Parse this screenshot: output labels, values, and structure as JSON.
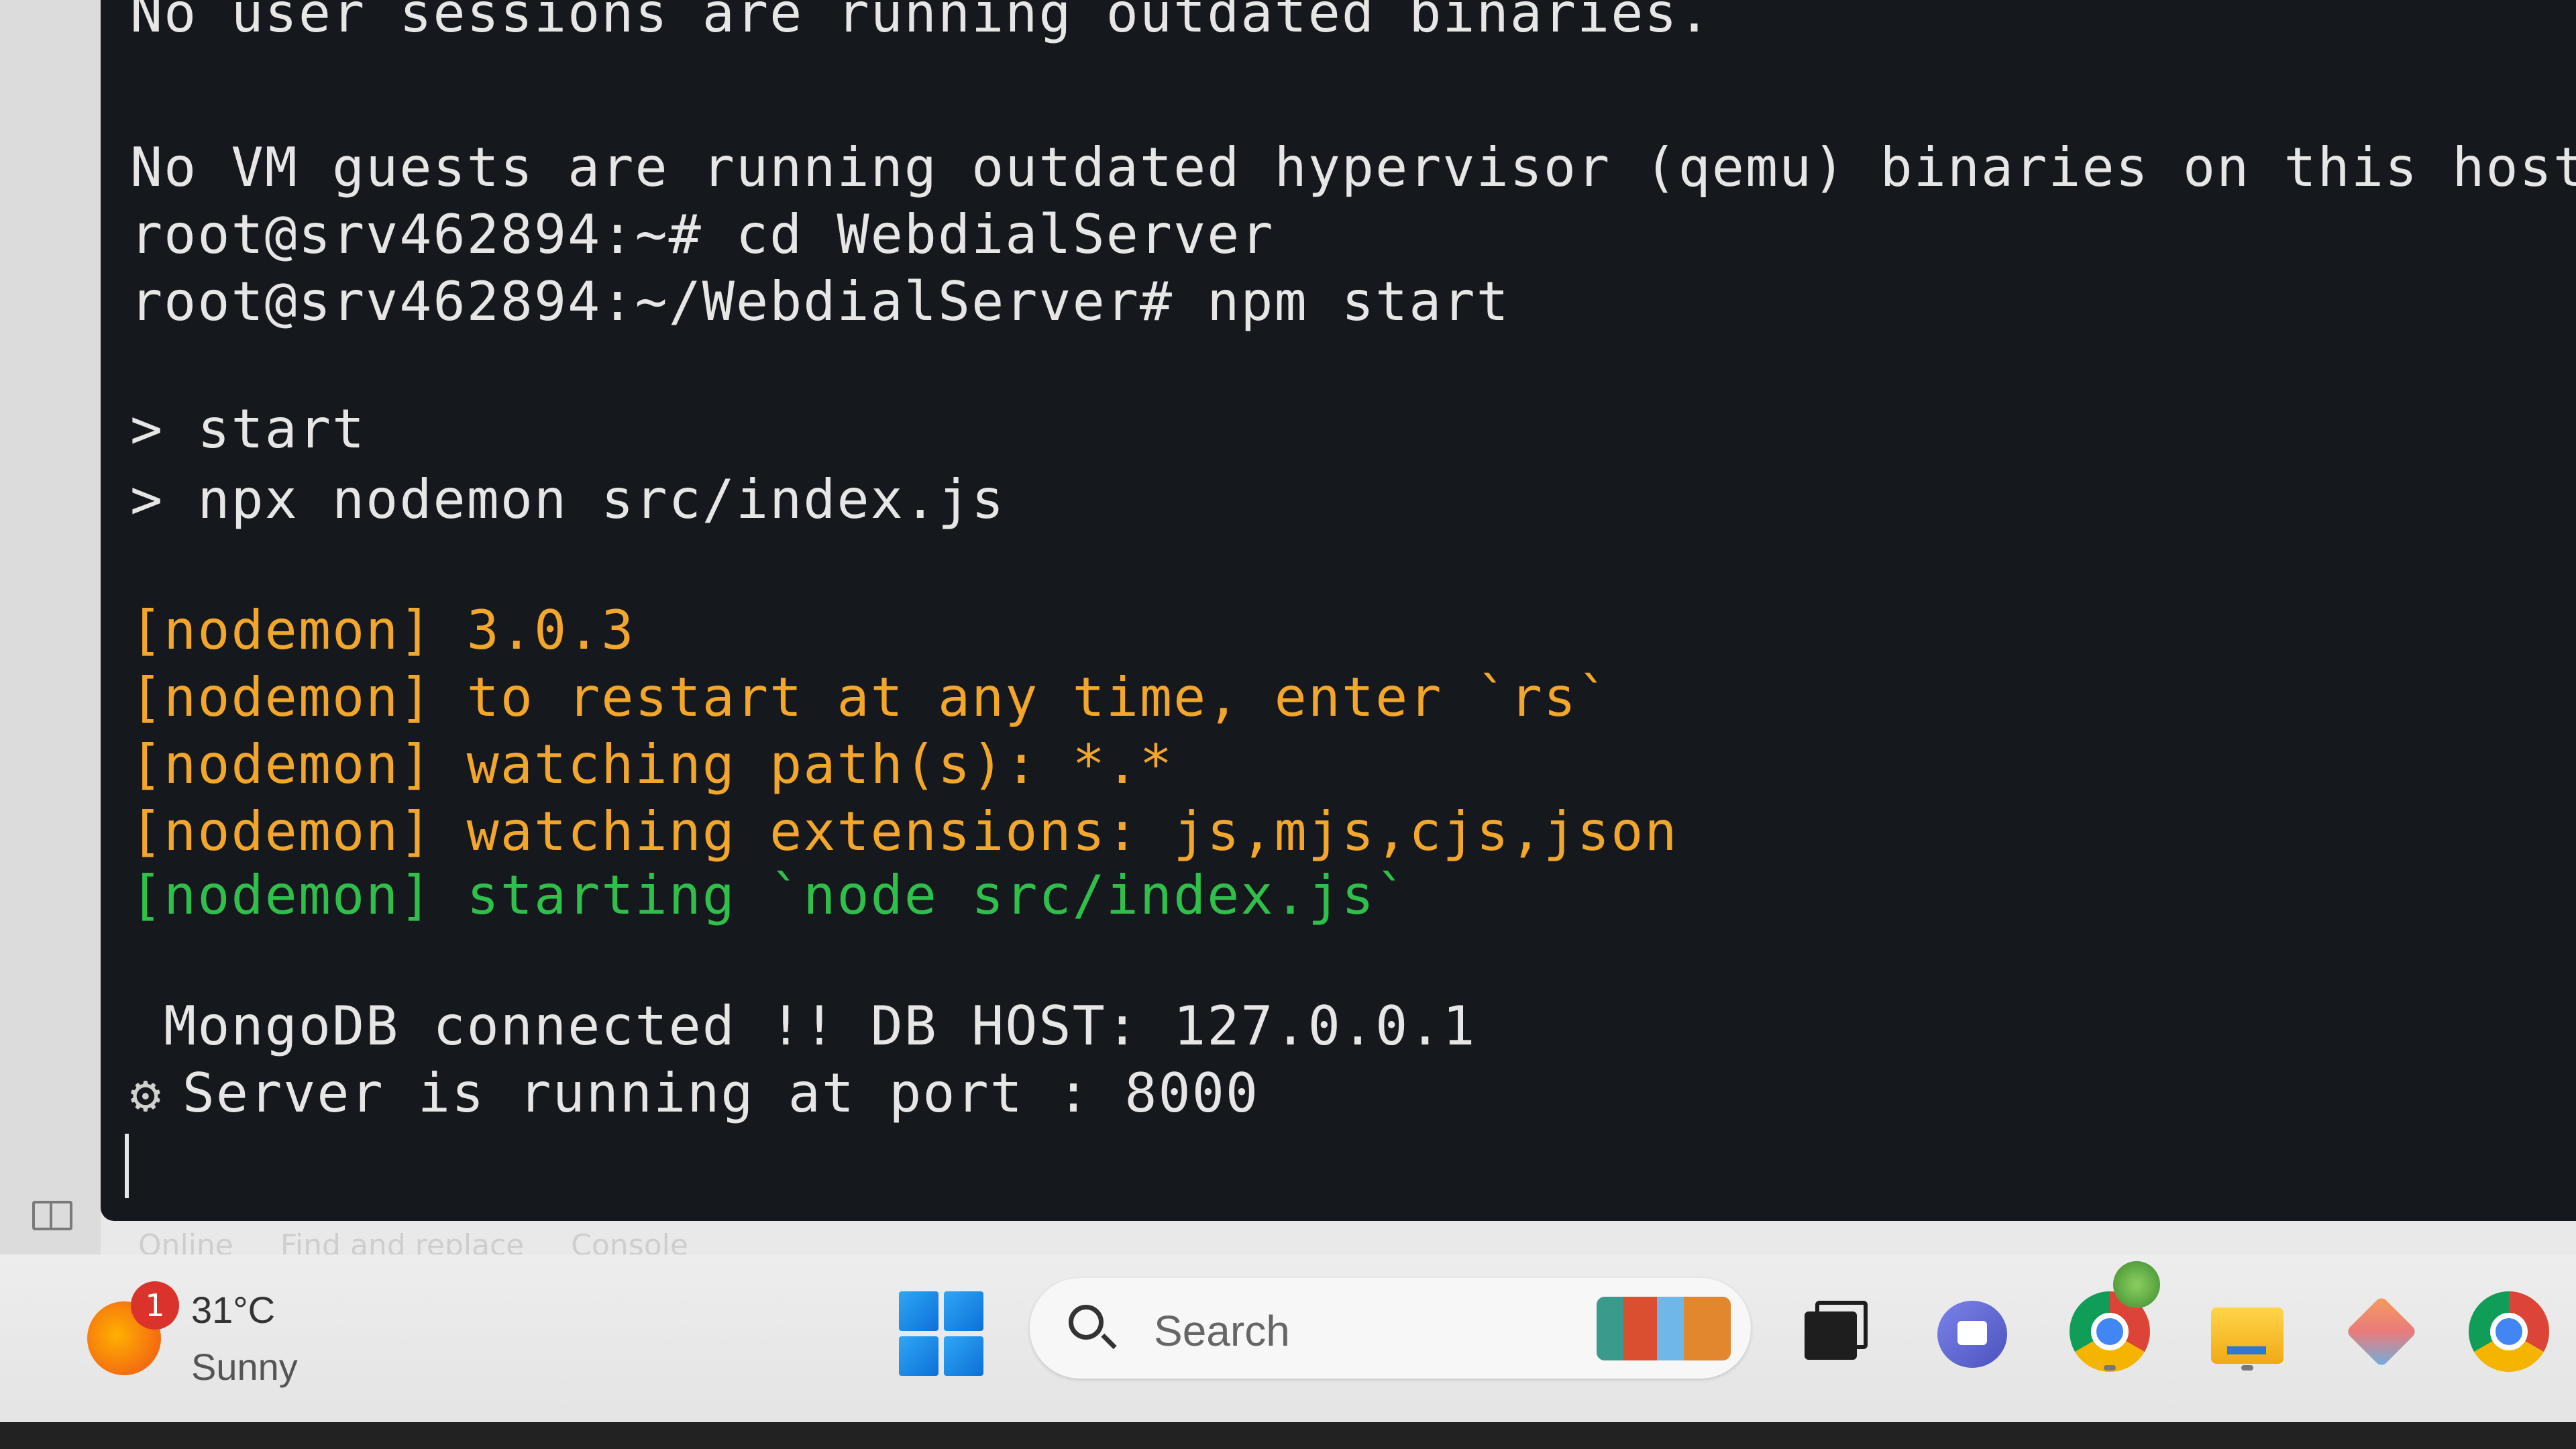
{
  "terminal": {
    "lines": [
      {
        "text": "No user sessions are running outdated binaries.",
        "color": "#e6e6e6"
      },
      {
        "text": "",
        "color": "#e6e6e6"
      },
      {
        "text": "No VM guests are running outdated hypervisor (qemu) binaries on this host.",
        "color": "#e6e6e6"
      },
      {
        "text": "root@srv462894:~# cd WebdialServer",
        "color": "#e6e6e6"
      },
      {
        "text": "root@srv462894:~/WebdialServer# npm start",
        "color": "#e6e6e6"
      },
      {
        "text": "",
        "color": "#e6e6e6"
      },
      {
        "text": "> start",
        "color": "#e6e6e6"
      },
      {
        "text": "> npx nodemon src/index.js",
        "color": "#e6e6e6"
      },
      {
        "text": "",
        "color": "#e6e6e6"
      },
      {
        "text": "[nodemon] 3.0.3",
        "color": "#f2a62b"
      },
      {
        "text": "[nodemon] to restart at any time, enter `rs`",
        "color": "#f2a62b"
      },
      {
        "text": "[nodemon] watching path(s): *.*",
        "color": "#f2a62b"
      },
      {
        "text": "[nodemon] watching extensions: js,mjs,cjs,json",
        "color": "#f2a62b"
      },
      {
        "text": "[nodemon] starting `node src/index.js`",
        "color": "#2fbf4a"
      },
      {
        "text": "",
        "color": "#e6e6e6"
      },
      {
        "text": " MongoDB connected !! DB HOST: 127.0.0.1",
        "color": "#e6e6e6"
      },
      {
        "text": "Server is running at port : 8000",
        "color": "#e6e6e6",
        "icon": "gear-icon"
      }
    ]
  },
  "status_strip": {
    "items": [
      "Online",
      "Find and replace",
      "Console"
    ]
  },
  "taskbar": {
    "weather": {
      "temperature": "31°C",
      "condition": "Sunny",
      "badge_count": "1",
      "icon": "weather-sun-icon"
    },
    "search": {
      "label": "Search",
      "icon": "search-icon"
    },
    "apps": [
      {
        "name": "start-button",
        "icon": "windows-logo-icon"
      },
      {
        "name": "task-view",
        "icon": "task-view-icon"
      },
      {
        "name": "meet",
        "icon": "video-call-icon"
      },
      {
        "name": "chrome-profile",
        "icon": "chrome-icon"
      },
      {
        "name": "file-explorer",
        "icon": "folder-icon"
      },
      {
        "name": "git-client",
        "icon": "git-icon"
      },
      {
        "name": "chrome",
        "icon": "chrome-icon"
      }
    ]
  },
  "colors": {
    "terminal_bg": "#15181d",
    "text_default": "#e6e6e6",
    "nodemon_yellow": "#f2a62b",
    "nodemon_green": "#2fbf4a"
  }
}
